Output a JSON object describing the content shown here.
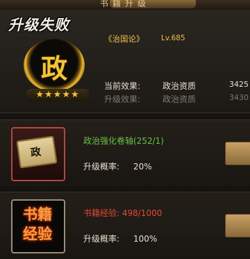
{
  "header": {
    "title": "书籍升级"
  },
  "result": {
    "title": "升级失败",
    "emblem_glyph": "政",
    "stars": "★★★★★",
    "star_count": 5,
    "book_name": "《治国论》",
    "book_level": "Lv.685",
    "current": {
      "label": "当前效果:",
      "attribute": "政治资质",
      "value": "3425"
    },
    "next": {
      "label": "升级效果:",
      "attribute": "政治资质",
      "value": "3430"
    }
  },
  "items": [
    {
      "icon": "scroll-icon",
      "icon_text": "政",
      "name": "政治强化卷轴(252/1)",
      "name_color": "#69c34a",
      "rate_label": "升级概率:",
      "rate_value": "20%"
    },
    {
      "icon": "book-exp-icon",
      "icon_text": "书籍经验",
      "name": "书籍经验: 498/1000",
      "name_color": "#e44a36",
      "rate_label": "升级概率:",
      "rate_value": "100%"
    }
  ],
  "colors": {
    "accent_gold": "#f0c24a",
    "success_green": "#69c34a",
    "warning_red": "#e44a36"
  }
}
